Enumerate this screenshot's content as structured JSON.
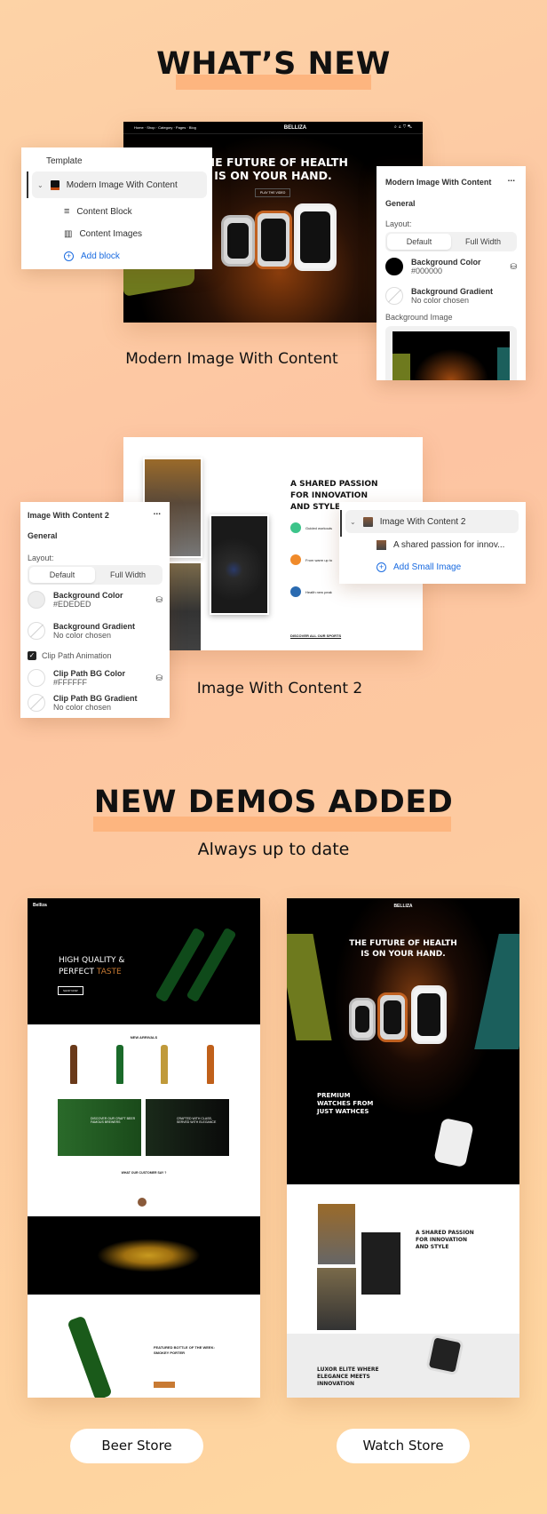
{
  "section1": {
    "title": "WHAT’S NEW"
  },
  "demo1": {
    "caption": "Modern Image With Content",
    "hero": {
      "brand": "BELLIZA",
      "headline_1": "THE FUTURE OF HEALTH",
      "headline_2": "IS ON YOUR HAND.",
      "cta": "PLAY THE VIDEO",
      "nav": [
        "Home",
        "Shop",
        "Category",
        "Pages",
        "Blog"
      ]
    },
    "tree": {
      "heading": "Template",
      "section": "Modern Image With Content",
      "blocks": [
        "Content Block",
        "Content Images"
      ],
      "add": "Add block"
    },
    "settings": {
      "title": "Modern Image With Content",
      "menu": "...",
      "group": "General",
      "layout_label": "Layout:",
      "layout_options": [
        "Default",
        "Full Width"
      ],
      "layout_selected": "Default",
      "bg_color_label": "Background Color",
      "bg_color_value": "#000000",
      "bg_gradient_label": "Background Gradient",
      "bg_gradient_value": "No color chosen",
      "bg_image_label": "Background Image"
    }
  },
  "demo2": {
    "caption": "Image With Content 2",
    "content": {
      "headline_1": "A SHARED PASSION",
      "headline_2": "FOR INNOVATION",
      "headline_3": "AND STYLE",
      "features": [
        "Guided workouts",
        "From warm up to",
        "Health new peak"
      ],
      "link": "DISCOVER ALL OUR SPORTS"
    },
    "settings": {
      "title": "Image With Content 2",
      "menu": "...",
      "group": "General",
      "layout_label": "Layout:",
      "layout_options": [
        "Default",
        "Full Width"
      ],
      "layout_selected": "Default",
      "bg_color_label": "Background Color",
      "bg_color_value": "#EDEDED",
      "bg_gradient_label": "Background Gradient",
      "bg_gradient_value": "No color chosen",
      "clip_label": "Clip Path Animation",
      "clip_checked": true,
      "clip_color_label": "Clip Path BG Color",
      "clip_color_value": "#FFFFFF",
      "clip_gradient_label": "Clip Path BG Gradient",
      "clip_gradient_value": "No color chosen"
    },
    "tree": {
      "section": "Image With Content 2",
      "block": "A shared passion for innov...",
      "add": "Add Small Image"
    }
  },
  "section2": {
    "title": "NEW DEMOS ADDED",
    "subtitle": "Always up to date"
  },
  "demos": [
    {
      "label": "Beer Store",
      "brand": "Belliza",
      "hero_1": "HIGH QUALITY &",
      "hero_2": "PERFECT",
      "hero_accent": "TASTE",
      "hero_btn": "SHOP NOW",
      "arrivals": "NEW ARRIVALS",
      "banner_1": "DISCOVER OUR CRAFT BEER FAMOUS BREWERS",
      "banner_2": "CRAFTED WITH CLASS, SERVED WITH ELEGANCE",
      "testimonials": "WHAT OUR CUSTOMER SAY ?",
      "featured_1": "FEATURED BOTTLE OF THE WEEK:",
      "featured_2": "SMOKEY PORTER"
    },
    {
      "label": "Watch Store",
      "brand": "BELLIZA",
      "hero_1": "THE FUTURE OF HEALTH",
      "hero_2": "IS ON YOUR HAND.",
      "premium_1": "PREMIUM",
      "premium_2": "WATCHES FROM",
      "premium_3": "JUST WATHCES",
      "passion_1": "A SHARED PASSION",
      "passion_2": "FOR INNOVATION",
      "passion_3": "AND STYLE",
      "luxor_1": "LUXOR ELITE WHERE",
      "luxor_2": "ELEGANCE MEETS",
      "luxor_3": "INNOVATION"
    }
  ],
  "colors": {
    "accent": "#fdb57f",
    "link": "#1a6be0",
    "beer_accent": "#c87a33"
  }
}
